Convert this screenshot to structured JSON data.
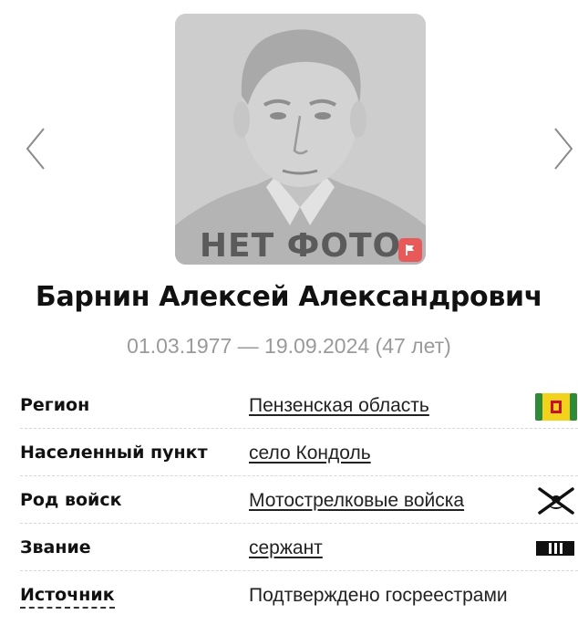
{
  "photo": {
    "placeholder_text": "НЕТ ФОТО",
    "flag_color": "#e85a5a"
  },
  "navigation": {
    "prev_icon": "chevron-left-icon",
    "next_icon": "chevron-right-icon"
  },
  "person": {
    "name": "Барнин Алексей Александрович",
    "dates": "01.03.1977 — 19.09.2024 (47 лет)"
  },
  "info": {
    "rows": [
      {
        "label": "Регион",
        "value": "Пензенская область",
        "link": true,
        "icon": "region-flag-icon"
      },
      {
        "label": "Населенный пункт",
        "value": "село Кондоль",
        "link": true,
        "icon": ""
      },
      {
        "label": "Род войск",
        "value": "Мотострелковые войска",
        "link": true,
        "icon": "crossed-rifles-icon"
      },
      {
        "label": "Звание",
        "value": "сержант",
        "link": true,
        "icon": "rank-stripes-icon"
      },
      {
        "label": "Источник",
        "value": "Подтверждено госреестрами",
        "link": false,
        "icon": ""
      }
    ]
  },
  "colors": {
    "dates_text": "#9a9a9a",
    "region_flag_yellow": "#f2d21b",
    "region_flag_green": "#2f8a3a"
  }
}
